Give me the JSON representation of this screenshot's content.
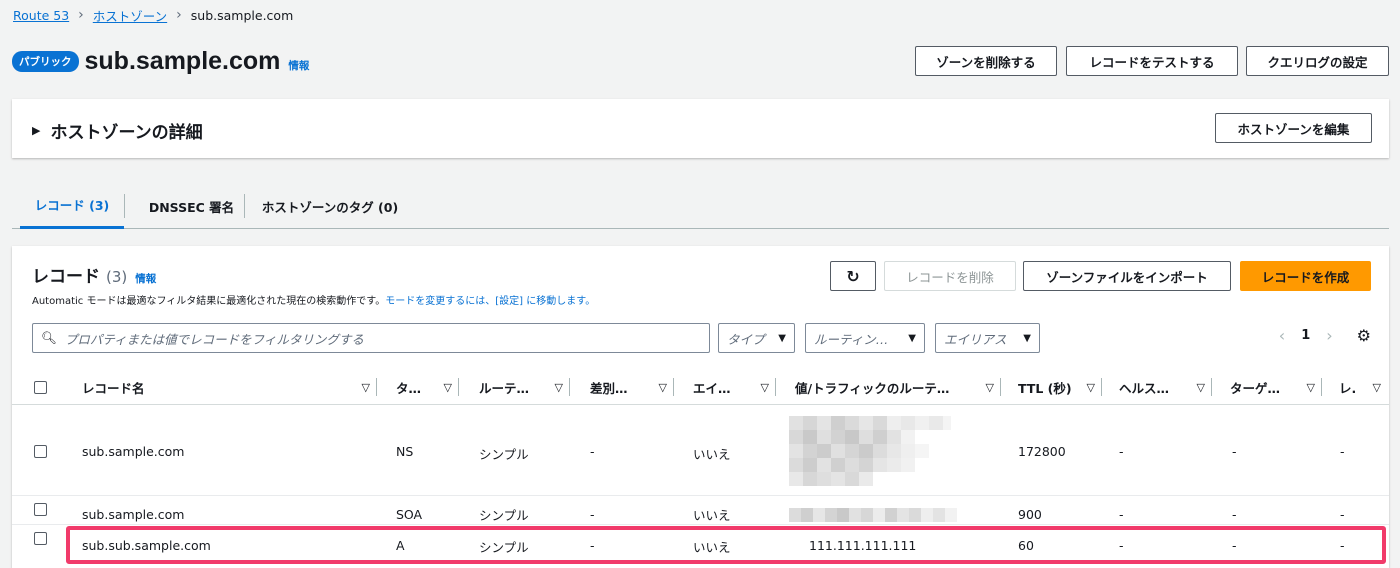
{
  "breadcrumb": {
    "root": "Route 53",
    "zones": "ホストゾーン",
    "current": "sub.sample.com"
  },
  "header": {
    "badge": "パブリック",
    "title": "sub.sample.com",
    "info": "情報",
    "buttons": {
      "delete_zone": "ゾーンを削除する",
      "test_record": "レコードをテストする",
      "query_log": "クエリログの設定"
    }
  },
  "details": {
    "title": "ホストゾーンの詳細",
    "edit": "ホストゾーンを編集"
  },
  "tabs": [
    "レコード (3)",
    "DNSSEC 署名",
    "ホストゾーンのタグ (0)"
  ],
  "records": {
    "title": "レコード",
    "count": "(3)",
    "info": "情報",
    "desc_plain": "Automatic モードは最適なフィルタ結果に最適化された現在の検索動作です。",
    "desc_link": "モードを変更するには、[設定] に移動します。",
    "buttons": {
      "refresh_icon": "refresh-icon",
      "delete": "レコードを削除",
      "import": "ゾーンファイルをインポート",
      "create": "レコードを作成"
    },
    "search_placeholder": "プロパティまたは値でレコードをフィルタリングする",
    "filters": {
      "type": "タイプ",
      "routing": "ルーティン…",
      "alias": "エイリアス"
    },
    "page": "1",
    "columns": [
      "レコード名",
      "タ…",
      "ルーテ…",
      "差別…",
      "エイ…",
      "値/トラフィックのルーテ…",
      "TTL (秒)",
      "ヘルス…",
      "ターゲ…",
      "レ."
    ],
    "rows": [
      {
        "name": "sub.sample.com",
        "type": "NS",
        "routing": "シンプル",
        "diff": "-",
        "alias": "いいえ",
        "value": "",
        "ttl": "172800",
        "health": "-",
        "target": "-",
        "r": "-"
      },
      {
        "name": "sub.sample.com",
        "type": "SOA",
        "routing": "シンプル",
        "diff": "-",
        "alias": "いいえ",
        "value": "",
        "ttl": "900",
        "health": "-",
        "target": "-",
        "r": "-"
      },
      {
        "name": "sub.sub.sample.com",
        "type": "A",
        "routing": "シンプル",
        "diff": "-",
        "alias": "いいえ",
        "value": "111.111.111.111",
        "ttl": "60",
        "health": "-",
        "target": "-",
        "r": "-"
      }
    ]
  },
  "colors": {
    "accent": "#0972d3",
    "primary": "#ff9900",
    "highlight": "#f13a6a"
  }
}
